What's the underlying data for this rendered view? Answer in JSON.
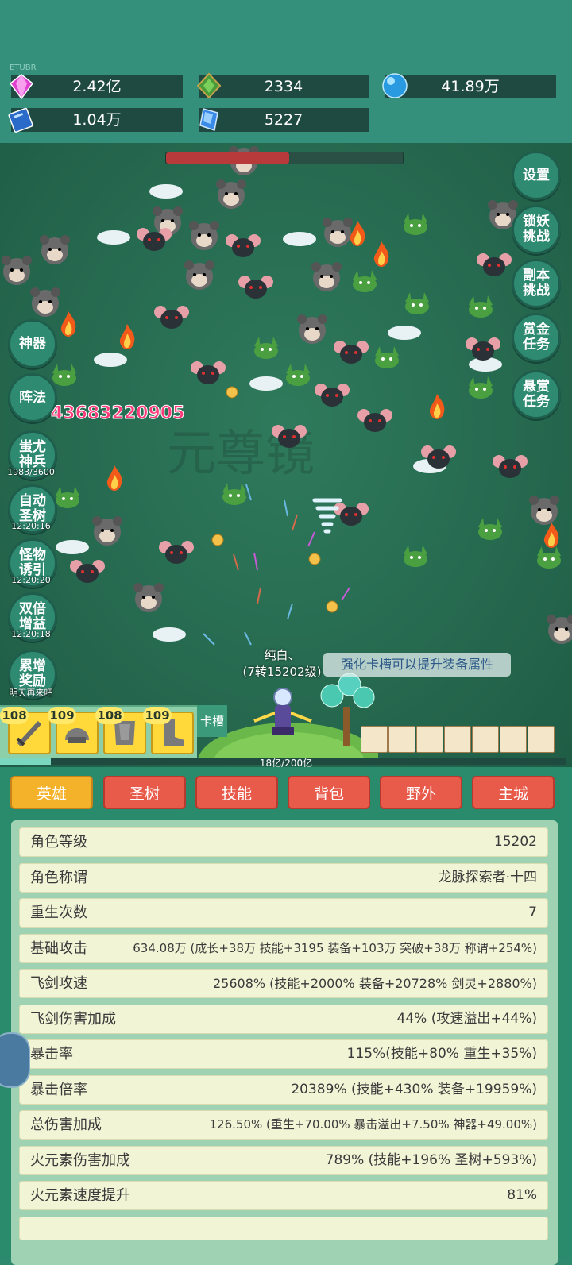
{
  "resources": {
    "tiny_label": "ETUBR",
    "gem": "2.42亿",
    "green_crystal": "2334",
    "blue_orb": "41.89万",
    "book": "1.04万",
    "blue_shard": "5227"
  },
  "boss_hp_fraction": 0.52,
  "right_buttons": [
    "设置",
    "锁妖\n挑战",
    "副本\n挑战",
    "赏金\n任务",
    "悬赏\n任务"
  ],
  "left_buttons": [
    {
      "label": "神器",
      "timer": ""
    },
    {
      "label": "阵法",
      "timer": ""
    },
    {
      "label": "蚩尤\n神兵",
      "timer": "1983/3600"
    },
    {
      "label": "自动\n圣树",
      "timer": "12:20:16"
    },
    {
      "label": "怪物\n诱引",
      "timer": "12:20:20"
    },
    {
      "label": "双倍\n增益",
      "timer": "12:20:18"
    },
    {
      "label": "累增\n奖励",
      "timer": "明天再来吧"
    }
  ],
  "damage_number": "43683220905",
  "watermark": "元尊镜",
  "player": {
    "name": "纯白、",
    "rank": "(7转15202级)"
  },
  "tip": "强化卡槽可以提升装备属性",
  "equipment": [
    {
      "level": "108",
      "icon": "sword-icon"
    },
    {
      "level": "109",
      "icon": "helmet-icon"
    },
    {
      "level": "108",
      "icon": "armor-icon"
    },
    {
      "level": "109",
      "icon": "boots-icon"
    }
  ],
  "card_slot": "卡槽",
  "xp_text": "18亿/200亿",
  "xp_fraction": 0.09,
  "tabs": [
    "英雄",
    "圣树",
    "技能",
    "背包",
    "野外",
    "主城"
  ],
  "active_tab": "英雄",
  "stats": [
    {
      "k": "角色等级",
      "v": "15202"
    },
    {
      "k": "角色称谓",
      "v": "龙脉探索者·十四"
    },
    {
      "k": "重生次数",
      "v": "7"
    },
    {
      "k": "基础攻击",
      "v": "634.08万 (成长+38万 技能+3195 装备+103万 突破+38万 称谓+254%)"
    },
    {
      "k": "飞剑攻速",
      "v": "25608% (技能+2000% 装备+20728% 剑灵+2880%)"
    },
    {
      "k": "飞剑伤害加成",
      "v": "44% (攻速溢出+44%)"
    },
    {
      "k": "暴击率",
      "v": "115%(技能+80% 重生+35%)"
    },
    {
      "k": "暴击倍率",
      "v": "20389% (技能+430% 装备+19959%)"
    },
    {
      "k": "总伤害加成",
      "v": "126.50% (重生+70.00% 暴击溢出+7.50% 神器+49.00%)"
    },
    {
      "k": "火元素伤害加成",
      "v": "789% (技能+196% 圣树+593%)"
    },
    {
      "k": "火元素速度提升",
      "v": "81%"
    }
  ]
}
